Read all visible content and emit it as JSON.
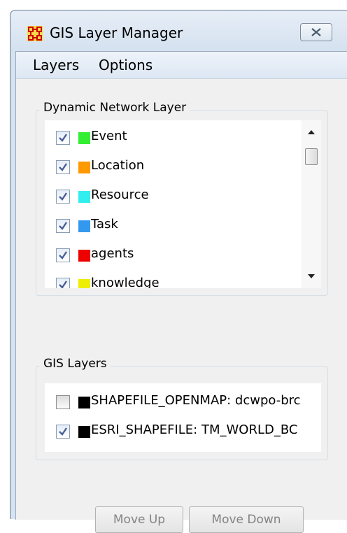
{
  "window": {
    "title": "GIS Layer Manager"
  },
  "menu": [
    {
      "label": "Layers"
    },
    {
      "label": "Options"
    }
  ],
  "dynamic_network_layer": {
    "title": "Dynamic Network Layer",
    "items": [
      {
        "label": "Event",
        "color": "#33ee33",
        "checked": true
      },
      {
        "label": "Location",
        "color": "#ff9900",
        "checked": true
      },
      {
        "label": "Resource",
        "color": "#33eeee",
        "checked": true
      },
      {
        "label": "Task",
        "color": "#3399ee",
        "checked": true
      },
      {
        "label": "agents",
        "color": "#ee0000",
        "checked": true
      },
      {
        "label": "knowledge",
        "color": "#eeee00",
        "checked": true
      }
    ]
  },
  "gis_layers": {
    "title": "GIS Layers",
    "items": [
      {
        "label": "SHAPEFILE_OPENMAP: dcwpo-brc",
        "color": "#000000",
        "checked": false
      },
      {
        "label": "ESRI_SHAPEFILE: TM_WORLD_BC",
        "color": "#000000",
        "checked": true
      }
    ]
  },
  "buttons": {
    "move_up": "Move Up",
    "move_down": "Move Down"
  }
}
